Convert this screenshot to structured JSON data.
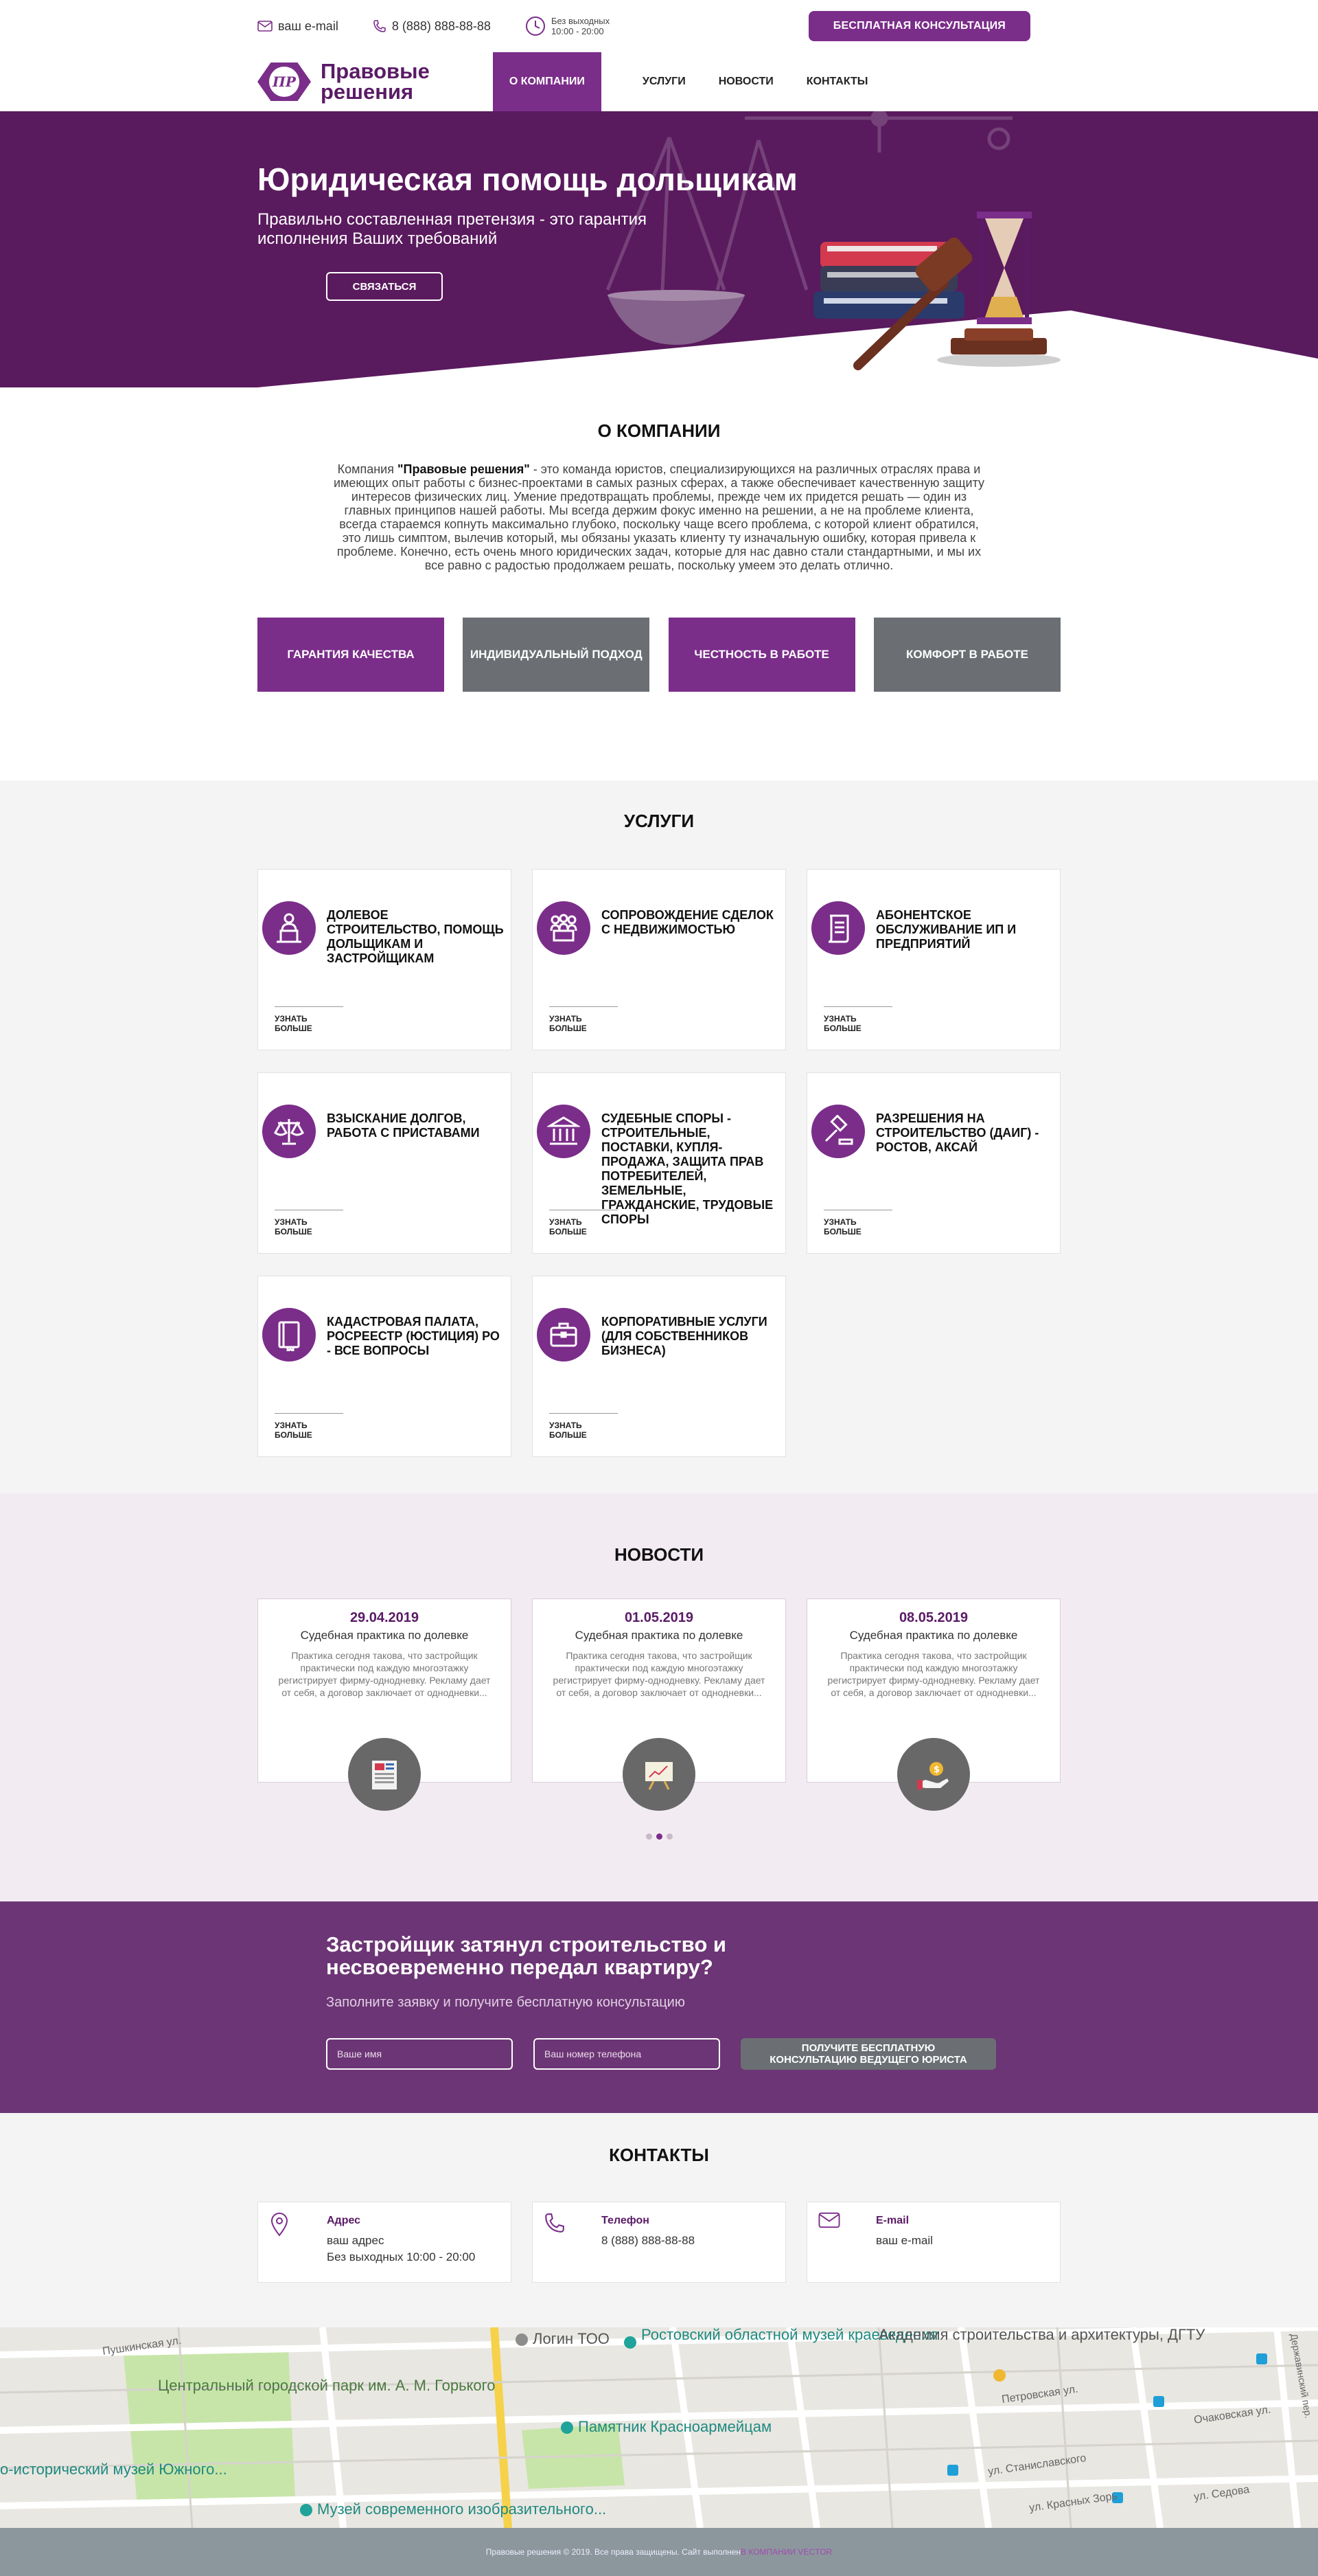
{
  "topbar": {
    "email": "ваш e-mail",
    "phone": "8 (888) 888-88-88",
    "hours_line1": "Без выходных",
    "hours_line2": "10:00 - 20:00",
    "consult_button": "БЕСПЛАТНАЯ КОНСУЛЬТАЦИЯ"
  },
  "logo": {
    "mark": "ПР",
    "line1": "Правовые",
    "line2": "решения"
  },
  "nav": [
    {
      "label": "О КОМПАНИИ",
      "active": true
    },
    {
      "label": "УСЛУГИ"
    },
    {
      "label": "НОВОСТИ"
    },
    {
      "label": "КОНТАКТЫ"
    }
  ],
  "hero": {
    "title": "Юридическая помощь дольщикам",
    "subtitle": "Правильно составленная претензия - это гарантия исполнения Ваших требований",
    "cta": "СВЯЗАТЬСЯ"
  },
  "about": {
    "title": "О КОМПАНИИ",
    "text_before": "Компания ",
    "company": "\"Правовые решения\"",
    "text_after": " - это команда юристов, специализирующихся на различных отраслях права и имеющих опыт работы с бизнес-проектами в самых разных сферах, а также обеспечивает качественную защиту интересов физических лиц. Умение предотвращать проблемы, прежде чем их придется решать — один из главных принципов нашей работы. Мы всегда держим фокус именно на решении, а не на проблеме клиента, всегда стараемся копнуть максимально глубоко, поскольку чаще всего проблема, с которой клиент обратился, это лишь симптом, вылечив который, мы обязаны указать клиенту ту изначальную ошибку, которая привела к проблеме. Конечно, есть очень много юридических задач, которые для нас давно стали стандартными, и мы их все равно с радостью продолжаем решать, поскольку умеем это делать отлично.",
    "features": [
      "ГАРАНТИЯ КАЧЕСТВА",
      "ИНДИВИДУАЛЬНЫЙ ПОДХОД",
      "ЧЕСТНОСТЬ В РАБОТЕ",
      "КОМФОРТ В РАБОТЕ"
    ]
  },
  "services": {
    "title": "УСЛУГИ",
    "more_label": "УЗНАТЬ БОЛЬШЕ",
    "items": [
      {
        "title": "ДОЛЕВОЕ СТРОИТЕЛЬСТВО, ПОМОЩЬ ДОЛЬЩИКАМ И ЗАСТРОЙЩИКАМ",
        "icon": "speaker-podium-icon"
      },
      {
        "title": "СОПРОВОЖДЕНИЕ СДЕЛОК С НЕДВИЖИМОСТЬЮ",
        "icon": "meeting-icon"
      },
      {
        "title": "АБОНЕНТСКОЕ ОБСЛУЖИВАНИЕ ИП И ПРЕДПРИЯТИЙ",
        "icon": "scroll-document-icon"
      },
      {
        "title": "ВЗЫСКАНИЕ ДОЛГОВ, РАБОТА С ПРИСТАВАМИ",
        "icon": "scales-icon"
      },
      {
        "title": "СУДЕБНЫЕ СПОРЫ - СТРОИТЕЛЬНЫЕ, ПОСТАВКИ, КУПЛЯ-ПРОДАЖА, ЗАЩИТА ПРАВ ПОТРЕБИТЕЛЕЙ, ЗЕМЕЛЬНЫЕ, ГРАЖДАНСКИЕ, ТРУДОВЫЕ СПОРЫ",
        "icon": "courthouse-icon"
      },
      {
        "title": "РАЗРЕШЕНИЯ НА СТРОИТЕЛЬСТВО (ДАИГ) - РОСТОВ, АКСАЙ",
        "icon": "gavel-icon"
      },
      {
        "title": "КАДАСТРОВАЯ ПАЛАТА, РОСРЕЕСТР (ЮСТИЦИЯ) РО - ВСЕ ВОПРОСЫ",
        "icon": "book-icon"
      },
      {
        "title": "КОРПОРАТИВНЫЕ УСЛУГИ (ДЛЯ СОБСТВЕННИКОВ БИЗНЕСА)",
        "icon": "briefcase-icon"
      }
    ]
  },
  "news": {
    "title": "НОВОСТИ",
    "items": [
      {
        "date": "29.04.2019",
        "headline": "Судебная практика по долевке",
        "excerpt": "Практика сегодня такова, что застройщик практически под каждую многоэтажку регистрирует фирму-однодневку. Рекламу дает от себя, а договор заключает от однодневки..."
      },
      {
        "date": "01.05.2019",
        "headline": "Судебная практика по долевке",
        "excerpt": "Практика сегодня такова, что застройщик практически под каждую многоэтажку регистрирует фирму-однодневку. Рекламу дает от себя, а договор заключает от однодневки..."
      },
      {
        "date": "08.05.2019",
        "headline": "Судебная практика по долевке",
        "excerpt": "Практика сегодня такова, что застройщик практически под каждую многоэтажку регистрирует фирму-однодневку. Рекламу дает от себя, а договор заключает от однодневки..."
      }
    ]
  },
  "cta_form": {
    "title": "Застройщик затянул строительство и несвоевременно передал квартиру?",
    "lead": "Заполните заявку и получите бесплатную консультацию",
    "name_placeholder": "Ваше имя",
    "phone_placeholder": "Ваш номер телефона",
    "button_line1": "ПОЛУЧИТЕ БЕСПЛАТНУЮ",
    "button_line2": "КОНСУЛЬТАЦИЮ ВЕДУЩЕГО ЮРИСТА"
  },
  "contacts": {
    "title": "КОНТАКТЫ",
    "address_label": "Адрес",
    "address_line1": "ваш адрес",
    "address_line2": "Без выходных 10:00 - 20:00",
    "phone_label": "Телефон",
    "phone_value": "8 (888) 888-88-88",
    "email_label": "E-mail",
    "email_value": "ваш e-mail"
  },
  "map": {
    "labels": [
      "Логин ТОО",
      "Ростовский областной музей краеведения",
      "Академия строительства и архитектуры, ДГТУ",
      "Центральный городской парк им. А. М. Горького",
      "Памятник Красноармейцам",
      "Музей современного изобразительного...",
      "о-исторический музей Южного...",
      "Пушкинская ул.",
      "Петровская ул.",
      "ул. Станиславского",
      "ул. Красных Зорь",
      "ул. Седова",
      "Очаковская ул.",
      "Державинский пер."
    ]
  },
  "footer": {
    "text": "Правовые решения © 2019. Все права защищены. Сайт выполнен ",
    "link": "В КОМПАНИИ VECTOR"
  },
  "colors": {
    "primary": "#7b2d8a",
    "dark_purple": "#5a1a5e",
    "gray": "#6b6f73"
  }
}
